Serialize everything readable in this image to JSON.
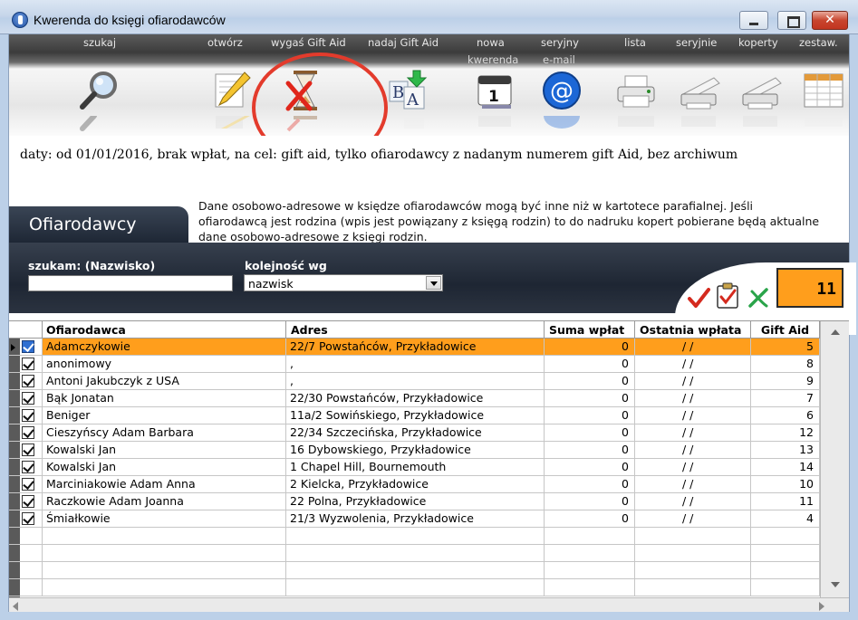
{
  "window": {
    "title": "Kwerenda do księgi ofiarodawców"
  },
  "toolbar": {
    "buttons": [
      {
        "label": "szukaj",
        "sublabel": "",
        "icon": "magnifier-icon"
      },
      {
        "label": "otwórz",
        "sublabel": "",
        "icon": "pencil-icon"
      },
      {
        "label": "wygaś Gift Aid",
        "sublabel": "",
        "icon": "hourglass-cancel-icon"
      },
      {
        "label": "nadaj Gift Aid",
        "sublabel": "",
        "icon": "assign-letters-icon"
      },
      {
        "label": "nowa",
        "sublabel": "kwerenda",
        "icon": "calendar-icon"
      },
      {
        "label": "seryjny",
        "sublabel": "e-mail",
        "icon": "at-sign-icon"
      },
      {
        "label": "lista",
        "sublabel": "",
        "icon": "printer-icon"
      },
      {
        "label": "seryjnie",
        "sublabel": "",
        "icon": "envelope-printer-icon"
      },
      {
        "label": "koperty",
        "sublabel": "",
        "icon": "envelope-printer-icon"
      },
      {
        "label": "zestaw.",
        "sublabel": "",
        "icon": "spreadsheet-icon"
      }
    ]
  },
  "filter": {
    "text": "daty: od 01/01/2016,  brak wpłat,  na cel: gift aid,  tylko ofiarodawcy z nadanym numerem gift Aid,  bez archiwum"
  },
  "section": {
    "title": "Ofiarodawcy",
    "notice": "Dane osobowo-adresowe w księdze ofiarodawców mogą być inne niż w kartotece parafialnej. Jeśli ofiarodawcą jest rodzina (wpis jest powiązany z księgą rodzin) to do nadruku kopert pobierane będą aktualne dane osobowo-adresowe z księgi rodzin."
  },
  "search": {
    "label": "szukam:  (Nazwisko)",
    "value": "",
    "order_label": "kolejność wg",
    "order_value": "nazwisk"
  },
  "count": "11",
  "grid": {
    "columns": [
      "Ofiarodawca",
      "Adres",
      "Suma wpłat",
      "Ostatnia wpłata",
      "Gift Aid"
    ],
    "rows": [
      {
        "name": "Adamczykowie",
        "address": "22/7 Powstańców, Przykładowice",
        "sum": "0",
        "last": "/  /",
        "giftaid": "5",
        "selected": true
      },
      {
        "name": "anonimowy",
        "address": ",",
        "sum": "0",
        "last": "/  /",
        "giftaid": "8",
        "selected": false
      },
      {
        "name": "Antoni Jakubczyk z USA",
        "address": ",",
        "sum": "0",
        "last": "/  /",
        "giftaid": "9",
        "selected": false
      },
      {
        "name": "Bąk Jonatan",
        "address": "22/30 Powstańców, Przykładowice",
        "sum": "0",
        "last": "/  /",
        "giftaid": "7",
        "selected": false
      },
      {
        "name": "Beniger",
        "address": "11a/2 Sowińskiego, Przykładowice",
        "sum": "0",
        "last": "/  /",
        "giftaid": "6",
        "selected": false
      },
      {
        "name": "Cieszyńscy Adam Barbara",
        "address": "22/34 Szczecińska, Przykładowice",
        "sum": "0",
        "last": "/  /",
        "giftaid": "12",
        "selected": false
      },
      {
        "name": "Kowalski Jan",
        "address": "16 Dybowskiego, Przykładowice",
        "sum": "0",
        "last": "/  /",
        "giftaid": "13",
        "selected": false
      },
      {
        "name": "Kowalski Jan",
        "address": "1 Chapel Hill, Bournemouth",
        "sum": "0",
        "last": "/  /",
        "giftaid": "14",
        "selected": false
      },
      {
        "name": "Marciniakowie Adam Anna",
        "address": "2 Kielcka, Przykładowice",
        "sum": "0",
        "last": "/  /",
        "giftaid": "10",
        "selected": false
      },
      {
        "name": "Raczkowie Adam Joanna",
        "address": "22 Polna, Przykładowice",
        "sum": "0",
        "last": "/  /",
        "giftaid": "11",
        "selected": false
      },
      {
        "name": "Śmiałkowie",
        "address": "21/3 Wyzwolenia, Przykładowice",
        "sum": "0",
        "last": "/  /",
        "giftaid": "4",
        "selected": false
      }
    ]
  },
  "colors": {
    "accent": "#ff9e1c",
    "header_dark": "#1e2633",
    "highlight": "#e33b2c"
  }
}
